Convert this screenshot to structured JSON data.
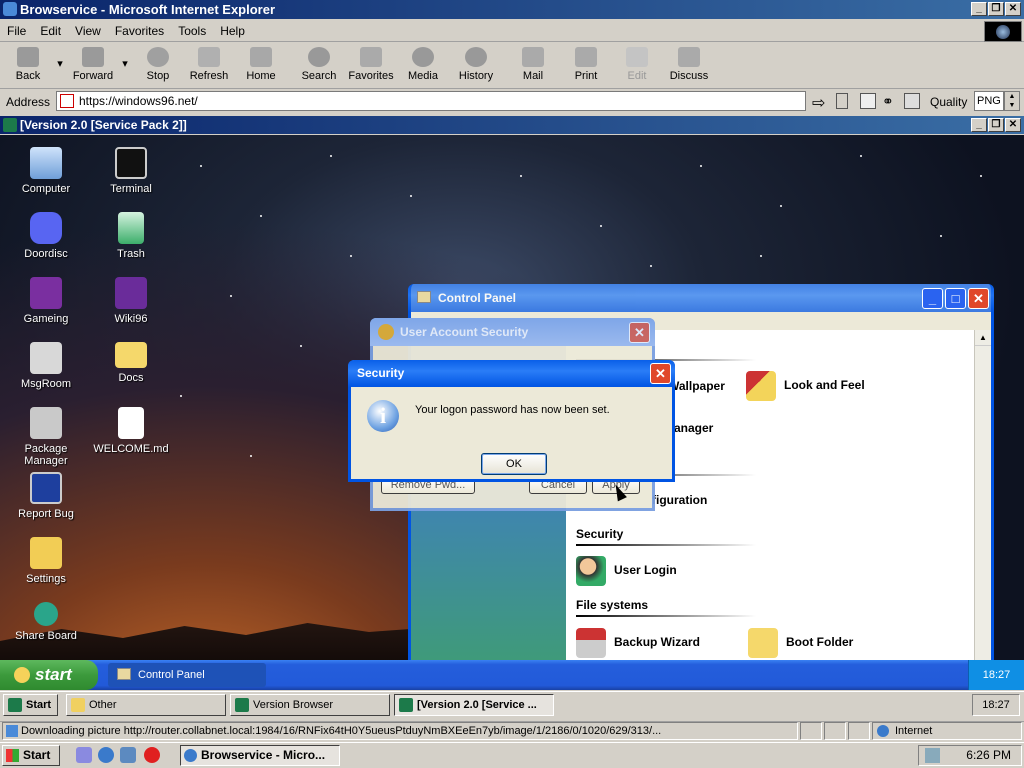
{
  "ie": {
    "title": "Browservice - Microsoft Internet Explorer",
    "menu": [
      "File",
      "Edit",
      "View",
      "Favorites",
      "Tools",
      "Help"
    ],
    "toolbar": [
      {
        "label": "Back",
        "icon": "back-arrow-icon"
      },
      {
        "label": "Forward",
        "icon": "forward-arrow-icon"
      },
      {
        "label": "Stop",
        "icon": "stop-icon"
      },
      {
        "label": "Refresh",
        "icon": "refresh-icon"
      },
      {
        "label": "Home",
        "icon": "home-icon"
      },
      {
        "label": "Search",
        "icon": "search-icon"
      },
      {
        "label": "Favorites",
        "icon": "favorites-icon"
      },
      {
        "label": "Media",
        "icon": "media-icon"
      },
      {
        "label": "History",
        "icon": "history-icon"
      },
      {
        "label": "Mail",
        "icon": "mail-icon"
      },
      {
        "label": "Print",
        "icon": "print-icon"
      },
      {
        "label": "Edit",
        "icon": "edit-icon"
      },
      {
        "label": "Discuss",
        "icon": "discuss-icon"
      }
    ],
    "address_label": "Address",
    "address_value": "https://windows96.net/",
    "quality_label": "Quality",
    "quality_value": "PNG",
    "status_text": "Downloading picture http://router.collabnet.local:1984/16/RNFix64tH0Y5ueusPtduyNmBXEeEn7yb/image/1/2186/0/1020/629/313/...",
    "zone": "Internet"
  },
  "inner": {
    "title": "[Version 2.0 [Service Pack 2]]",
    "desktop_icons": [
      {
        "label": "Computer",
        "icon": "computer-icon"
      },
      {
        "label": "Terminal",
        "icon": "terminal-icon"
      },
      {
        "label": "Doordisc",
        "icon": "doordisc-icon"
      },
      {
        "label": "Trash",
        "icon": "trash-icon"
      },
      {
        "label": "Gameing",
        "icon": "gameing-icon"
      },
      {
        "label": "Wiki96",
        "icon": "wiki-icon"
      },
      {
        "label": "MsgRoom",
        "icon": "msgroom-icon"
      },
      {
        "label": "Docs",
        "icon": "folder-icon"
      },
      {
        "label": "Package Manager",
        "icon": "package-icon"
      },
      {
        "label": "WELCOME.md",
        "icon": "markdown-file-icon"
      },
      {
        "label": "Report Bug",
        "icon": "report-bug-icon"
      },
      {
        "label": "Settings",
        "icon": "settings-icon"
      },
      {
        "label": "Share Board",
        "icon": "share-board-icon"
      }
    ],
    "control_panel": {
      "title": "Control Panel",
      "items": [
        "Wallpaper",
        "Look and Feel",
        "anager",
        "figuration"
      ],
      "sections": {
        "security": "Security",
        "file_systems": "File systems"
      },
      "user_login": "User Login",
      "backup_wizard": "Backup Wizard",
      "boot_folder": "Boot Folder"
    },
    "uas": {
      "title": "User Account Security",
      "remove_pwd": "Remove Pwd...",
      "cancel": "Cancel",
      "apply": "Apply"
    },
    "security": {
      "title": "Security",
      "message": "Your logon password has now been set.",
      "ok": "OK"
    },
    "xp_taskbar": {
      "start": "start",
      "task": "Control Panel",
      "clock": "18:27"
    },
    "classic_taskbar": {
      "start": "Start",
      "tasks": [
        "Other",
        "Version Browser",
        "[Version 2.0 [Service ..."
      ],
      "clock": "18:27"
    }
  },
  "host": {
    "start": "Start",
    "task": "Browservice - Micro...",
    "clock": "6:26 PM"
  }
}
